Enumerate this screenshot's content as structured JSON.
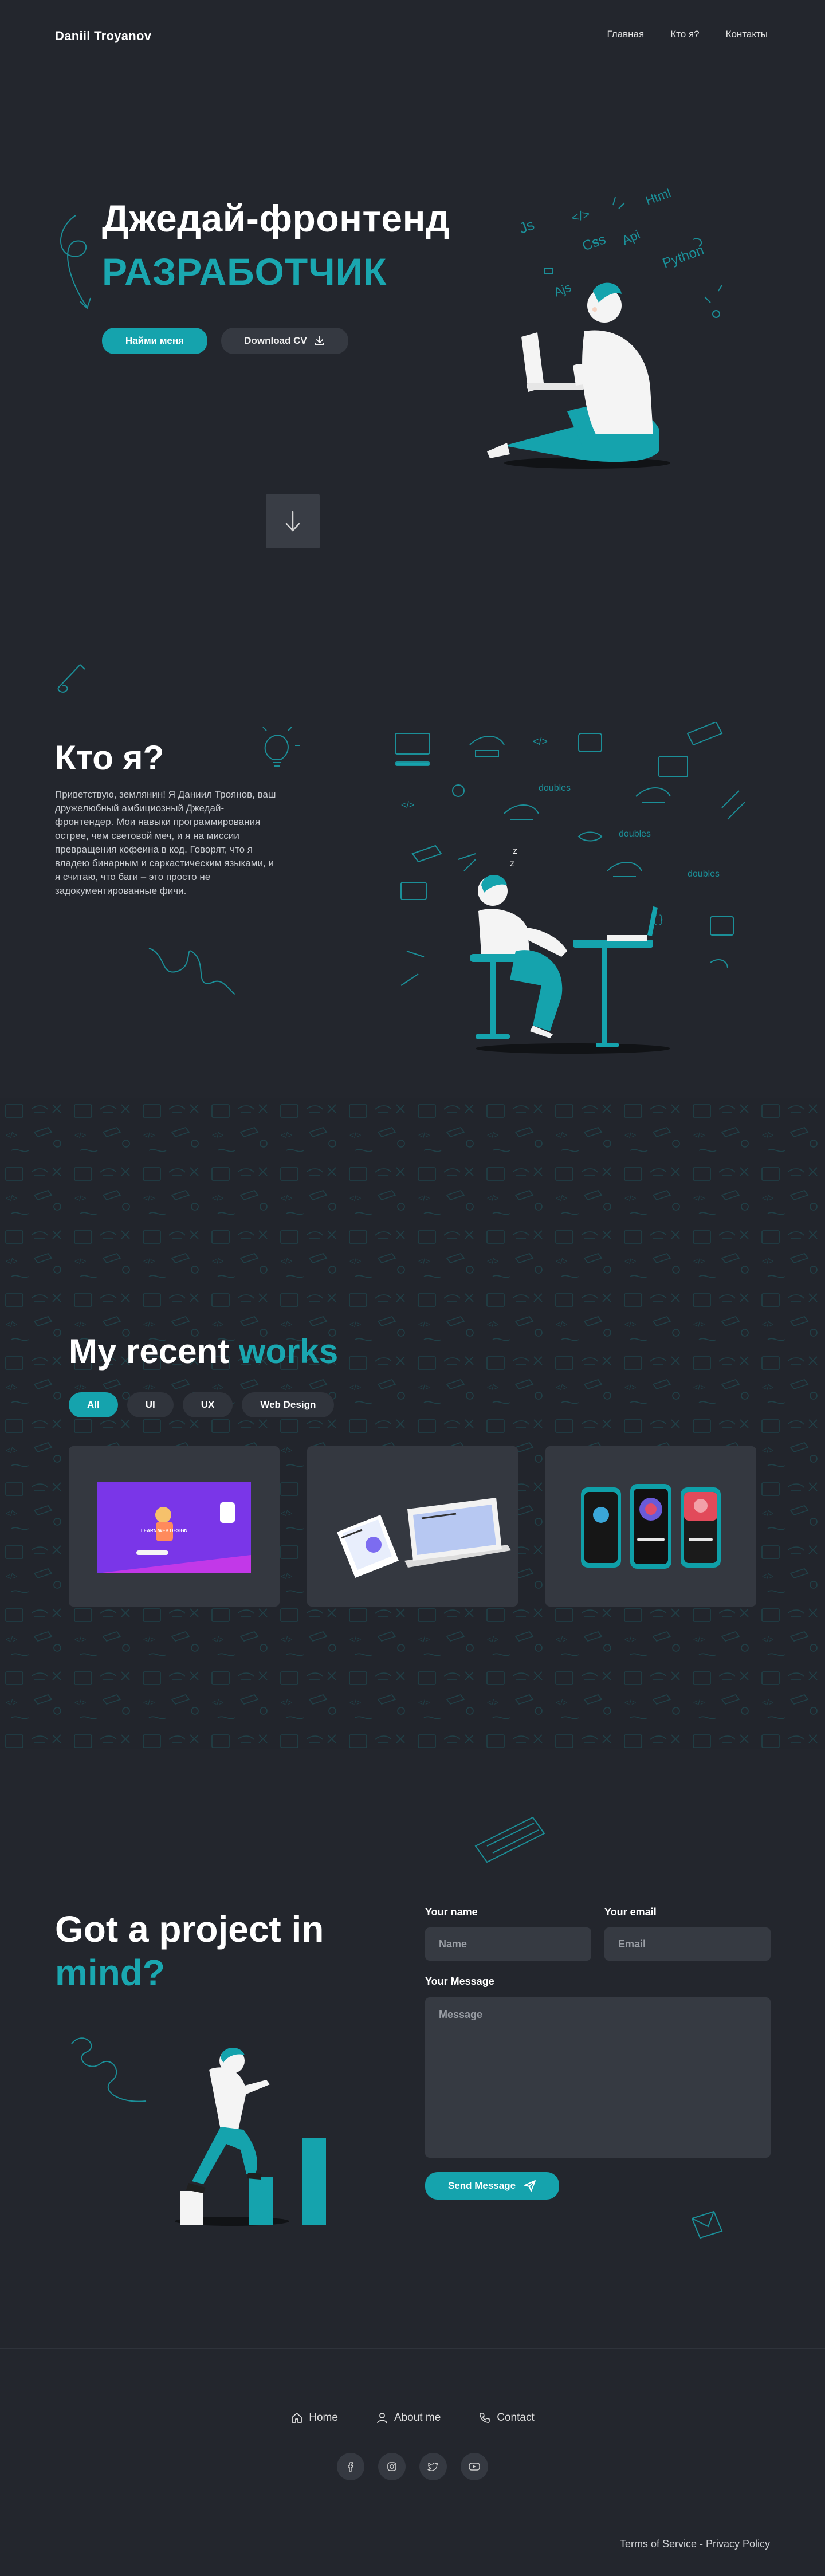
{
  "header": {
    "logo": "Daniil Troyanov",
    "nav": [
      "Главная",
      "Кто я?",
      "Контакты"
    ]
  },
  "hero": {
    "title_line1": "Джедай-фронтенд",
    "title_line2": "РАЗРАБОТЧИК",
    "cta_primary": "Найми меня",
    "cta_secondary": "Download CV",
    "scroll_icon": "arrow-down-icon"
  },
  "about": {
    "title": "Кто я?",
    "text": "Приветствую, землянин! Я Даниил Троянов, ваш дружелюбный амбициозный Джедай-фронтендер. Мои навыки программирования острее, чем световой меч, и я на миссии превращения кофеина в код. Говорят, что я владею бинарным и саркастическим языками, и я считаю, что баги – это просто не задокументированные фичи."
  },
  "works": {
    "title_plain": "My recent ",
    "title_accent": "works",
    "filters": [
      "All",
      "UI",
      "UX",
      "Web Design"
    ],
    "active_filter": "All",
    "card1_heading": "LEARN WEB DESIGN"
  },
  "contact": {
    "title_line1": "Got a project in",
    "title_line2": "mind?",
    "name_label": "Your name",
    "name_placeholder": "Name",
    "email_label": "Your email",
    "email_placeholder": "Email",
    "message_label": "Your Message",
    "message_placeholder": "Message",
    "send_label": "Send Message"
  },
  "footer": {
    "links": [
      "Home",
      "About me",
      "Contact"
    ],
    "socials": [
      "facebook-icon",
      "instagram-icon",
      "twitter-icon",
      "youtube-icon"
    ],
    "legal": "Terms of Service - Privacy Policy"
  },
  "colors": {
    "background": "#23262d",
    "accent": "#15a3ad",
    "surface": "#353941"
  }
}
